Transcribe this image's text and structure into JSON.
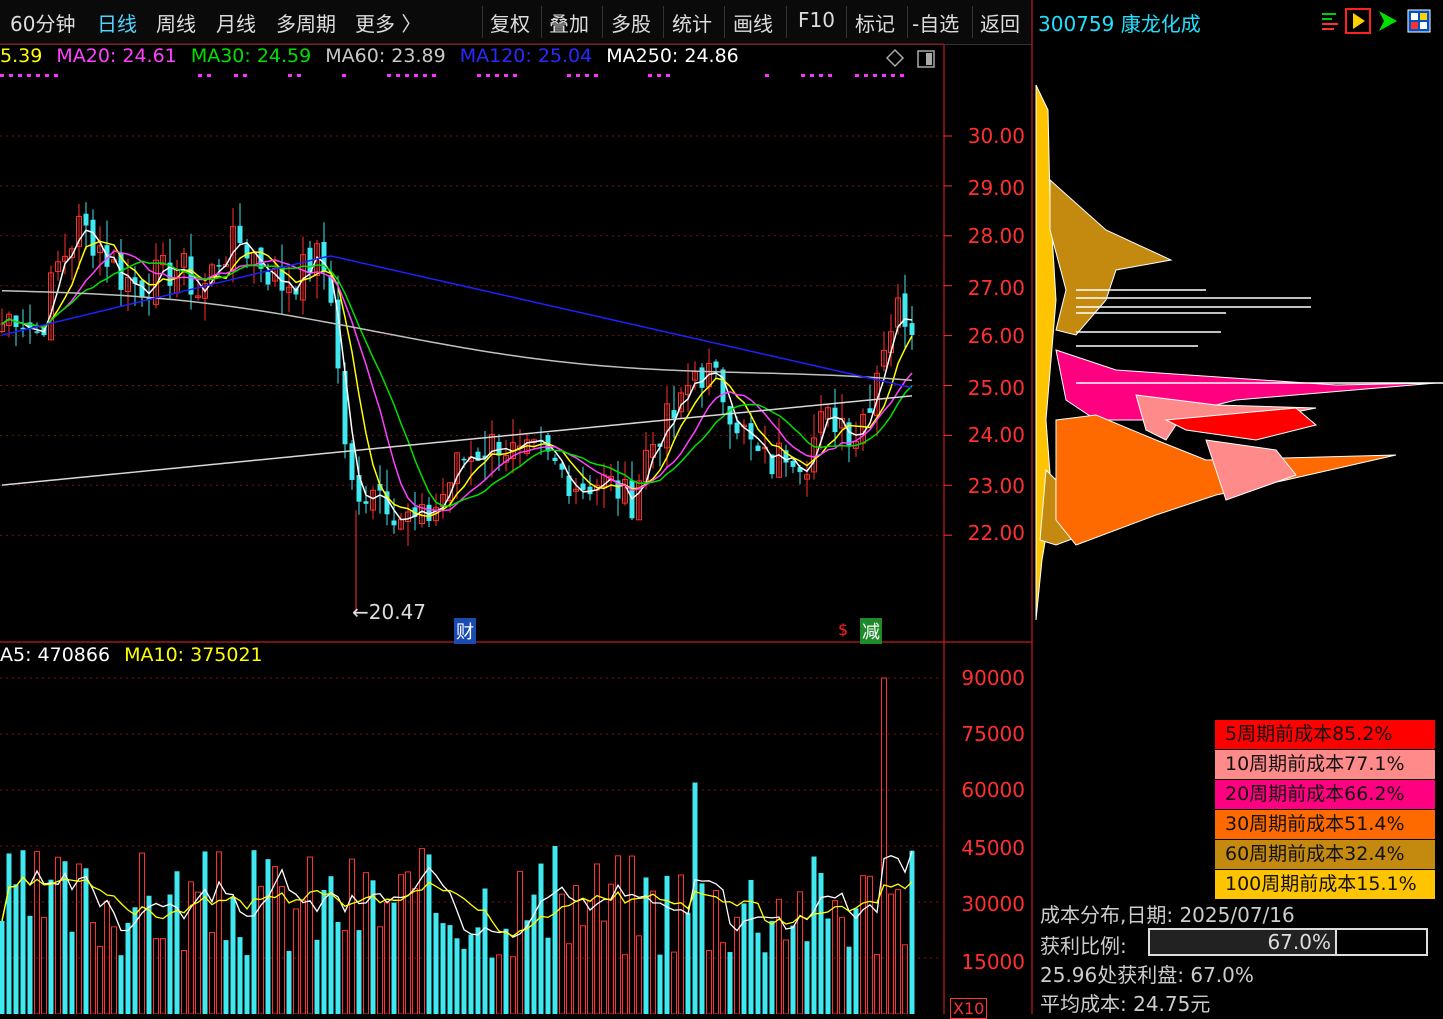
{
  "toolbar": {
    "period_current": "60分钟",
    "period_daily": "日线",
    "period_weekly": "周线",
    "period_monthly": "月线",
    "period_multi": "多周期",
    "more": "更多 〉",
    "fuquan": "复权",
    "diejia": "叠加",
    "duogu": "多股",
    "tongji": "统计",
    "huaxian": "画线",
    "f10": "F10",
    "biaoji": "标记",
    "zixuan": "-自选",
    "fanhui": "返回"
  },
  "stock": {
    "code_name": "300759 康龙化成"
  },
  "indicators": {
    "ma10": "5.39",
    "ma20": "MA20: 24.61",
    "ma30": "MA30: 24.59",
    "ma60": "MA60: 23.89",
    "ma120": "MA120: 25.04",
    "ma250": "MA250: 24.86"
  },
  "volume_indicators": {
    "ma5": "A5: 470866",
    "ma10": "MA10: 375021"
  },
  "price_axis": [
    "30.00",
    "29.00",
    "28.00",
    "27.00",
    "26.00",
    "25.00",
    "24.00",
    "23.00",
    "22.00"
  ],
  "volume_axis": [
    "90000",
    "75000",
    "60000",
    "45000",
    "30000",
    "15000"
  ],
  "annotations": {
    "low_price": "←20.47",
    "badge_cai": "财",
    "badge_jian": "减",
    "badge_s": "$",
    "x10": "X10"
  },
  "legend": [
    {
      "label": "5周期前成本85.2%",
      "color": "#ff0000"
    },
    {
      "label": "10周期前成本77.1%",
      "color": "#ff8a8a"
    },
    {
      "label": "20周期前成本66.2%",
      "color": "#ff0080"
    },
    {
      "label": "30周期前成本51.4%",
      "color": "#ff6a00"
    },
    {
      "label": "60周期前成本32.4%",
      "color": "#c48a10"
    },
    {
      "label": "100周期前成本15.1%",
      "color": "#ffc400"
    }
  ],
  "cost_info": {
    "date_line": "成本分布,日期:  2025/07/16",
    "profit_label": "获利比例:",
    "profit_value": "67.0%",
    "profit_ratio": 0.67,
    "profit_at": "25.96处获利盘: 67.0%",
    "avg_cost": "平均成本:  24.75元"
  },
  "colors": {
    "up": "#ff3030",
    "down": "#40e8f0",
    "ma5": "#ffffff",
    "ma10": "#ffff00",
    "ma20": "#ff40ff",
    "ma30": "#00e000",
    "ma60": "#c0c0c0",
    "ma120": "#2020ff"
  },
  "icons": [
    "list-icon",
    "play-icon",
    "arrow-icon",
    "grid-icon"
  ]
}
